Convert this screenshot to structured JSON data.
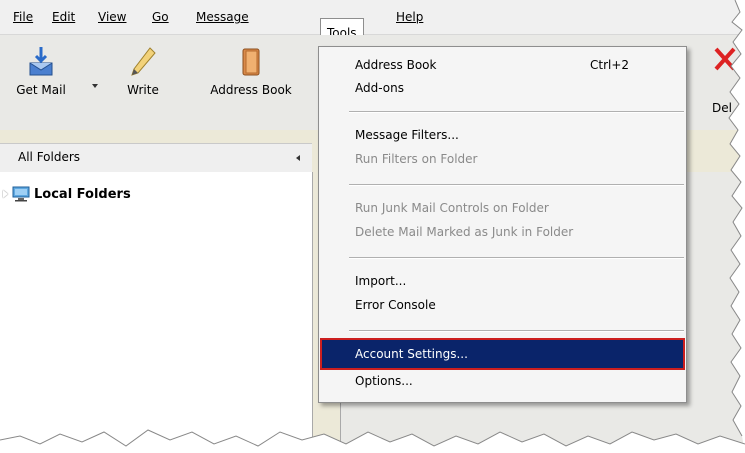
{
  "menubar": {
    "items": [
      {
        "label": "File"
      },
      {
        "label": "Edit"
      },
      {
        "label": "View"
      },
      {
        "label": "Go"
      },
      {
        "label": "Message"
      },
      {
        "label": "Tools"
      },
      {
        "label": "Help"
      }
    ]
  },
  "toolbar": {
    "get_mail": "Get Mail",
    "write": "Write",
    "address_book": "Address Book",
    "delete_partial": "Del"
  },
  "folders": {
    "header": "All Folders",
    "local_folders": "Local Folders"
  },
  "tools_menu": {
    "address_book": "Address Book",
    "address_book_shortcut": "Ctrl+2",
    "addons": "Add-ons",
    "message_filters": "Message Filters...",
    "run_filters": "Run Filters on Folder",
    "run_junk": "Run Junk Mail Controls on Folder",
    "delete_junk": "Delete Mail Marked as Junk in Folder",
    "import": "Import...",
    "error_console": "Error Console",
    "account_settings": "Account Settings...",
    "options": "Options..."
  },
  "colors": {
    "highlight": "#0a246a",
    "highlight_border": "#cc1f1f"
  }
}
